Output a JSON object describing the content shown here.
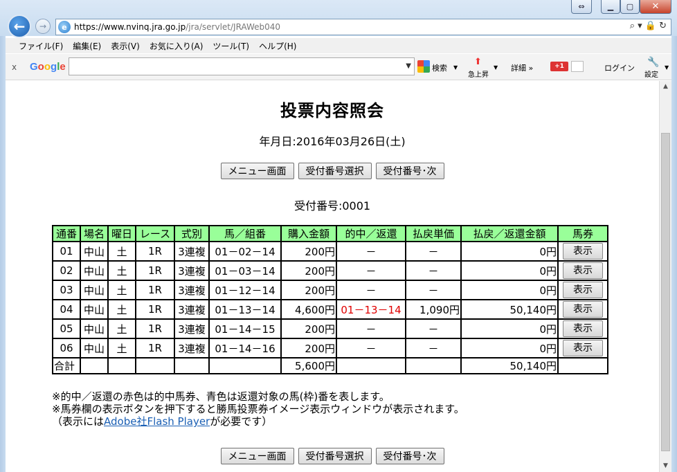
{
  "browser": {
    "url_prefix": "https://www.",
    "url_host": "nvinq.jra.go.jp",
    "url_path": "/jra/servlet/JRAWeb040",
    "addr_tools": "⌕ ▾ 🔒 ↻",
    "menu": [
      "ファイル(F)",
      "編集(E)",
      "表示(V)",
      "お気に入り(A)",
      "ツール(T)",
      "ヘルプ(H)"
    ],
    "toolbar": {
      "close": "x",
      "logo_letters": [
        {
          "ch": "G",
          "color": "#4285f4"
        },
        {
          "ch": "o",
          "color": "#ea4335"
        },
        {
          "ch": "o",
          "color": "#fbbc05"
        },
        {
          "ch": "g",
          "color": "#4285f4"
        },
        {
          "ch": "l",
          "color": "#34a853"
        },
        {
          "ch": "e",
          "color": "#ea4335"
        }
      ],
      "search_label": "検索",
      "trending_label": "急上昇",
      "more_label": "詳細 »",
      "gplus_label": "+1",
      "login_label": "ログイン",
      "settings_label": "設定"
    }
  },
  "page": {
    "title": "投票内容照会",
    "date_line": "年月日:2016年03月26日(土)",
    "buttons": [
      "メニュー画面",
      "受付番号選択",
      "受付番号･次"
    ],
    "receipt_line": "受付番号:0001"
  },
  "table": {
    "headers": [
      "通番",
      "場名",
      "曜日",
      "レース",
      "式別",
      "馬／組番",
      "購入金額",
      "的中／返還",
      "払戻単価",
      "払戻／返還金額",
      "馬券"
    ],
    "rows": [
      {
        "no": "01",
        "venue": "中山",
        "day": "土",
        "race": "1R",
        "type": "3連複",
        "combo": "01－02－14",
        "amount": "200円",
        "hit": "－",
        "hit_red": false,
        "unit": "－",
        "payout": "0円",
        "show": "表示"
      },
      {
        "no": "02",
        "venue": "中山",
        "day": "土",
        "race": "1R",
        "type": "3連複",
        "combo": "01－03－14",
        "amount": "200円",
        "hit": "－",
        "hit_red": false,
        "unit": "－",
        "payout": "0円",
        "show": "表示"
      },
      {
        "no": "03",
        "venue": "中山",
        "day": "土",
        "race": "1R",
        "type": "3連複",
        "combo": "01－12－14",
        "amount": "200円",
        "hit": "－",
        "hit_red": false,
        "unit": "－",
        "payout": "0円",
        "show": "表示"
      },
      {
        "no": "04",
        "venue": "中山",
        "day": "土",
        "race": "1R",
        "type": "3連複",
        "combo": "01－13－14",
        "amount": "4,600円",
        "hit": "01－13－14",
        "hit_red": true,
        "unit": "1,090円",
        "payout": "50,140円",
        "show": "表示"
      },
      {
        "no": "05",
        "venue": "中山",
        "day": "土",
        "race": "1R",
        "type": "3連複",
        "combo": "01－14－15",
        "amount": "200円",
        "hit": "－",
        "hit_red": false,
        "unit": "－",
        "payout": "0円",
        "show": "表示"
      },
      {
        "no": "06",
        "venue": "中山",
        "day": "土",
        "race": "1R",
        "type": "3連複",
        "combo": "01－14－16",
        "amount": "200円",
        "hit": "－",
        "hit_red": false,
        "unit": "－",
        "payout": "0円",
        "show": "表示"
      }
    ],
    "total": {
      "label": "合計",
      "amount": "5,600円",
      "payout": "50,140円"
    }
  },
  "notes": {
    "line1": "※的中／返還の赤色は的中馬券、青色は返還対象の馬(枠)番を表します。",
    "line2": "※馬券欄の表示ボタンを押下すると勝馬投票券イメージ表示ウィンドウが表示されます。",
    "line3_before": "（表示には",
    "line3_link": "Adobe社Flash Player",
    "line3_after": "が必要です）"
  },
  "colors": {
    "header_bg": "#99ff99",
    "hit_text": "#e00000",
    "link": "#1a5fb4"
  }
}
